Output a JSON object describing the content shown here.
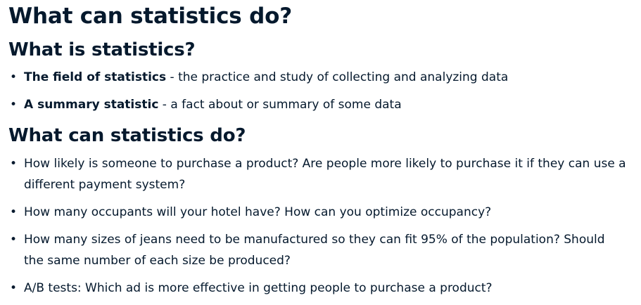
{
  "title": "What can statistics do?",
  "section1": {
    "heading": "What is statistics?",
    "items": [
      {
        "term": "The field of statistics",
        "desc": " - the practice and study of collecting and analyzing data"
      },
      {
        "term": "A summary statistic",
        "desc": " - a fact about or summary of some data"
      }
    ]
  },
  "section2": {
    "heading": "What can statistics do?",
    "items": [
      "How likely is someone to purchase a product? Are people more likely to purchase it if they can use a different payment system?",
      "How many occupants will your hotel have? How can you optimize occupancy?",
      "How many sizes of jeans need to be manufactured so they can fit 95% of the population? Should the same number of each size be produced?",
      "A/B tests: Which ad is more effective in getting people to purchase a product?"
    ]
  },
  "bullet_char": "•"
}
